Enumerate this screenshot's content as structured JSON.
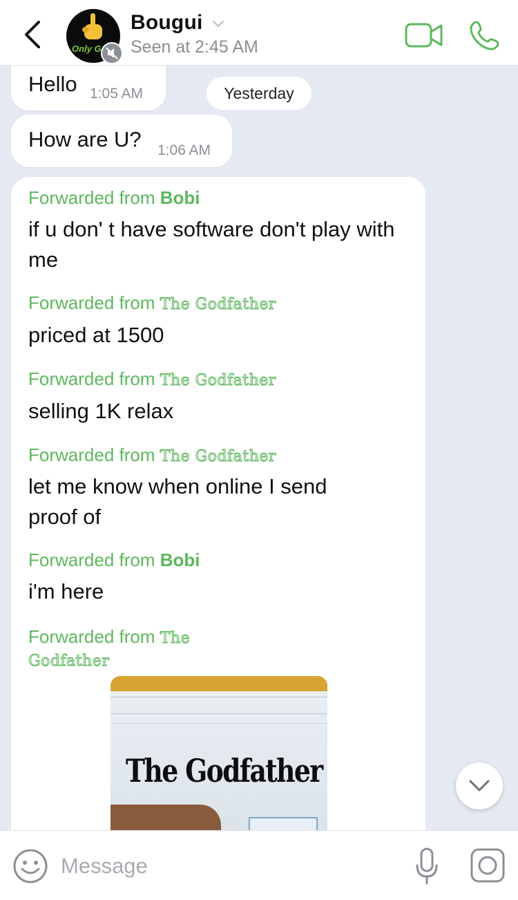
{
  "header": {
    "contact_name": "Bougui",
    "last_seen": "Seen at 2:45 AM",
    "avatar_text": "Only G",
    "icons": {
      "back": "chevron-left-icon",
      "chevron": "chevron-down-icon",
      "mute": "muted-speaker-icon",
      "video": "video-camera-icon",
      "call": "phone-icon"
    }
  },
  "chat": {
    "date_separator": "Yesterday",
    "messages": [
      {
        "text": "Hello",
        "time": "1:05 AM"
      },
      {
        "text": "How are U?",
        "time": "1:06 AM"
      }
    ],
    "forwarded_prefix": "Forwarded from ",
    "forwards": [
      {
        "from": "Bobi",
        "text": "if u don' t have software don't play with me"
      },
      {
        "from": "The Godfather",
        "text": "priced at 1500"
      },
      {
        "from": "The Godfather",
        "text": "selling 1K relax"
      },
      {
        "from": "The Godfather",
        "text": "let me know when online I send proof of"
      },
      {
        "from": "Bobi",
        "text": "i'm here"
      },
      {
        "from_line1": "The",
        "from_line2": "Godfather"
      }
    ],
    "photo_caption_text": "The Godfather"
  },
  "composer": {
    "placeholder": "Message",
    "value": ""
  },
  "colors": {
    "accent": "#5cb85c",
    "chat_background": "#e4e9f2",
    "bubble": "#ffffff",
    "secondary_text": "#8b8f96"
  }
}
